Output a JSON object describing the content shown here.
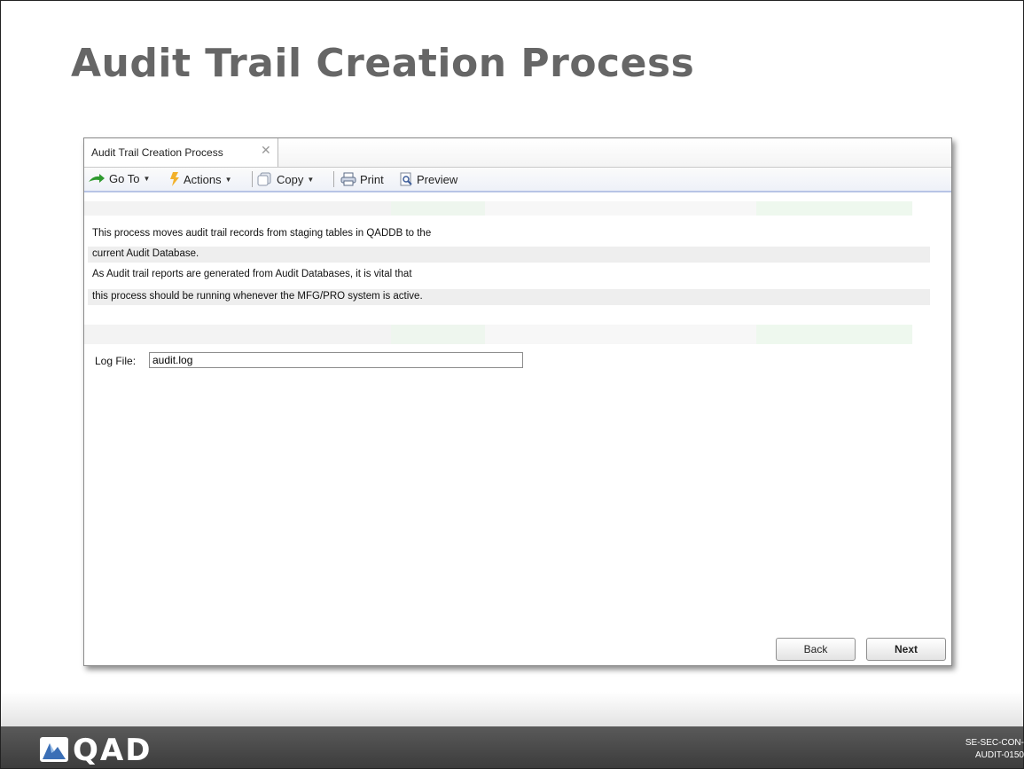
{
  "slide": {
    "title": "Audit Trail Creation Process",
    "footer_brand": "QAD",
    "slide_code_line1": "SE-SEC-CON-",
    "slide_code_line2": "AUDIT-0150"
  },
  "window": {
    "tab_label": "Audit Trail Creation Process",
    "tab_close": "✕",
    "toolbar": {
      "goto": "Go To",
      "actions": "Actions",
      "copy": "Copy",
      "print": "Print",
      "preview": "Preview"
    },
    "description_lines": [
      "This process moves audit trail records from staging tables in QADDB to the",
      "current Audit Database.",
      "As Audit trail reports are generated from Audit Databases, it is vital that",
      "this process should be running whenever the MFG/PRO system is active."
    ],
    "log_file": {
      "label": "Log File:",
      "value": "audit.log"
    },
    "buttons": {
      "back": "Back",
      "next": "Next"
    }
  },
  "colors": {
    "title_gray": "#666666",
    "footer_bar": "#4a4a4a",
    "toolbar_accent": "#b7c4e6"
  }
}
